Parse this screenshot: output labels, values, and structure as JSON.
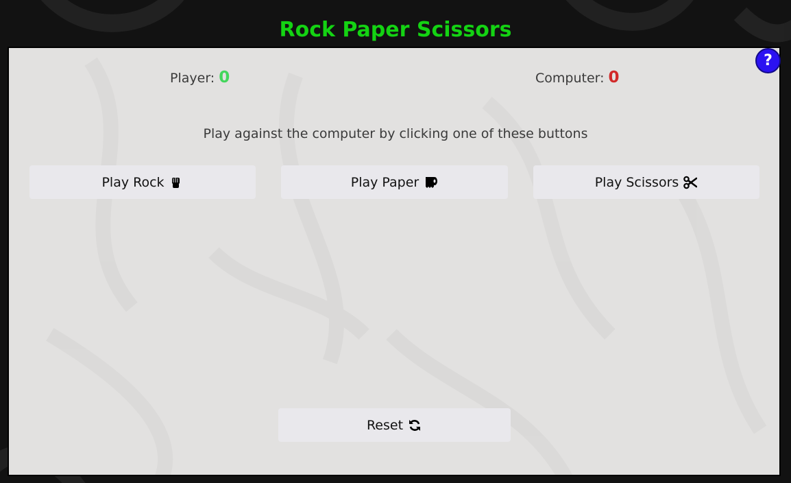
{
  "app": {
    "title": "Rock Paper Scissors"
  },
  "help": {
    "label": "?"
  },
  "scoreboard": {
    "player_label": "Player:",
    "player_score": "0",
    "computer_label": "Computer:",
    "computer_score": "0"
  },
  "instructions": "Play against the computer by clicking one of these buttons",
  "buttons": {
    "rock": {
      "label": "Play Rock",
      "icon": "hand-rock-icon"
    },
    "paper": {
      "label": "Play Paper",
      "icon": "toilet-paper-icon"
    },
    "scissors": {
      "label": "Play Scissors",
      "icon": "scissors-icon"
    },
    "reset": {
      "label": "Reset",
      "icon": "sync-icon"
    }
  },
  "colors": {
    "title": "#14d313",
    "player_score": "#43d65c",
    "computer_score": "#d12a2a",
    "help_button": "#2b12f2",
    "panel": "#e2e1e0",
    "page_background": "#121212"
  }
}
